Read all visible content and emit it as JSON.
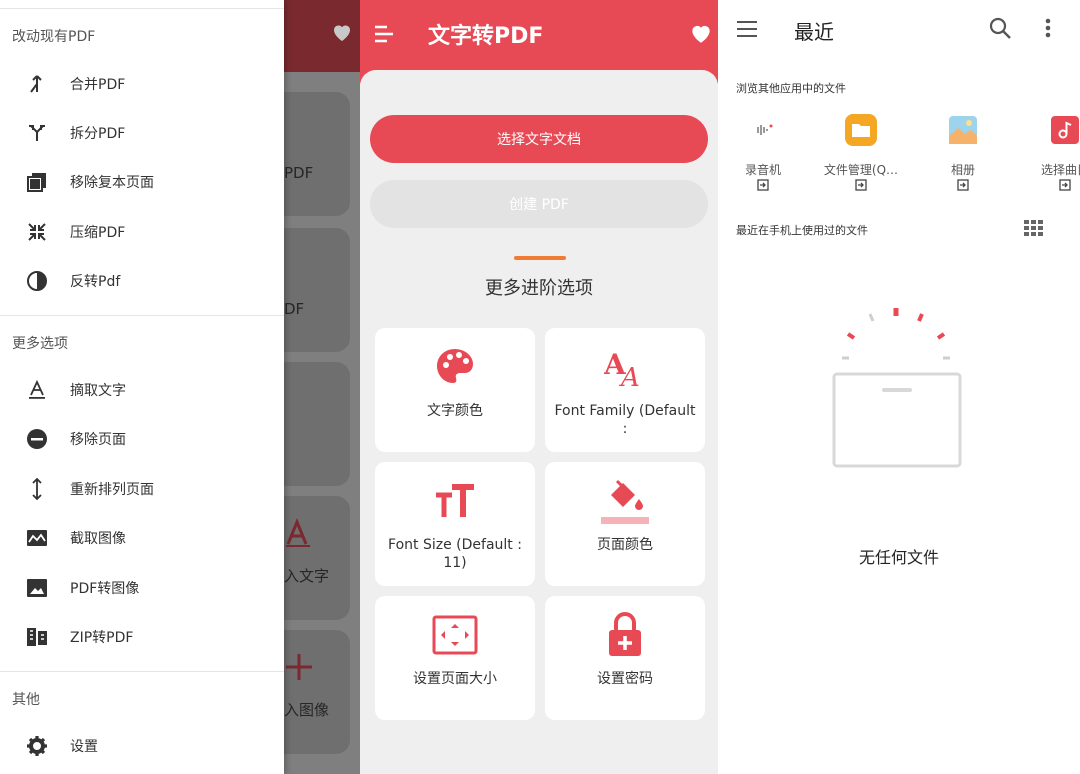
{
  "drawer": {
    "section1_title": "改动现有PDF",
    "section1_items": [
      {
        "label": "合并PDF",
        "icon": "merge-icon"
      },
      {
        "label": "拆分PDF",
        "icon": "split-icon"
      },
      {
        "label": "移除复本页面",
        "icon": "duplicate-icon"
      },
      {
        "label": "压缩PDF",
        "icon": "compress-icon"
      },
      {
        "label": "反转Pdf",
        "icon": "invert-icon"
      }
    ],
    "section2_title": "更多选项",
    "section2_items": [
      {
        "label": "摘取文字",
        "icon": "extract-text-icon"
      },
      {
        "label": "移除页面",
        "icon": "remove-page-icon"
      },
      {
        "label": "重新排列页面",
        "icon": "rearrange-icon"
      },
      {
        "label": "截取图像",
        "icon": "image-extract-icon"
      },
      {
        "label": "PDF转图像",
        "icon": "image-icon"
      },
      {
        "label": "ZIP转PDF",
        "icon": "zip-icon"
      }
    ],
    "section3_title": "其他",
    "section3_items": [
      {
        "label": "设置",
        "icon": "gear-icon"
      }
    ],
    "behind_labels": [
      "PDF",
      "DF",
      "入文字",
      "入图像"
    ]
  },
  "text_to_pdf": {
    "title": "文字转PDF",
    "select_button": "选择文字文档",
    "create_button": "创建 PDF",
    "more_options_title": "更多进阶选项",
    "options": [
      {
        "label": "文字颜色",
        "icon": "palette-icon"
      },
      {
        "label": "Font Family (Default :",
        "icon": "font-family-icon"
      },
      {
        "label": "Font Size (Default : 11)",
        "icon": "font-size-icon"
      },
      {
        "label": "页面颜色",
        "icon": "paint-bucket-icon"
      },
      {
        "label": "设置页面大小",
        "icon": "page-size-icon"
      },
      {
        "label": "设置密码",
        "icon": "lock-icon"
      }
    ],
    "accent_color": "#e84a55"
  },
  "recent": {
    "title": "最近",
    "browse_label": "浏览其他应用中的文件",
    "apps": [
      {
        "label": "录音机",
        "icon": "recorder-icon"
      },
      {
        "label": "文件管理(Q…",
        "icon": "file-manager-icon"
      },
      {
        "label": "相册",
        "icon": "gallery-icon"
      },
      {
        "label": "选择曲目",
        "icon": "music-icon"
      }
    ],
    "recent_label": "最近在手机上使用过的文件",
    "empty_text": "无任何文件"
  }
}
